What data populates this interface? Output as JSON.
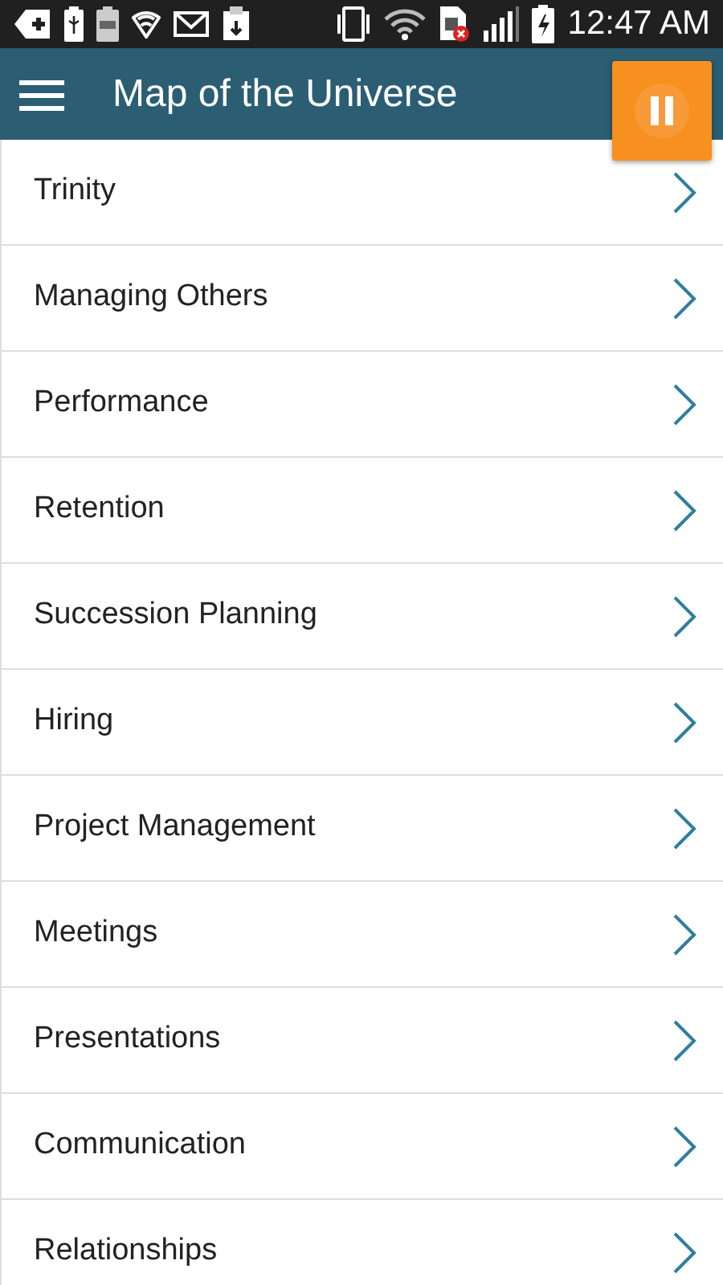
{
  "status_bar": {
    "time": "12:47 AM"
  },
  "app_bar": {
    "title": "Map of the Universe"
  },
  "items": [
    {
      "label": "Trinity"
    },
    {
      "label": "Managing Others"
    },
    {
      "label": "Performance"
    },
    {
      "label": "Retention"
    },
    {
      "label": "Succession Planning"
    },
    {
      "label": "Hiring"
    },
    {
      "label": "Project Management"
    },
    {
      "label": "Meetings"
    },
    {
      "label": "Presentations"
    },
    {
      "label": "Communication"
    },
    {
      "label": "Relationships"
    }
  ]
}
